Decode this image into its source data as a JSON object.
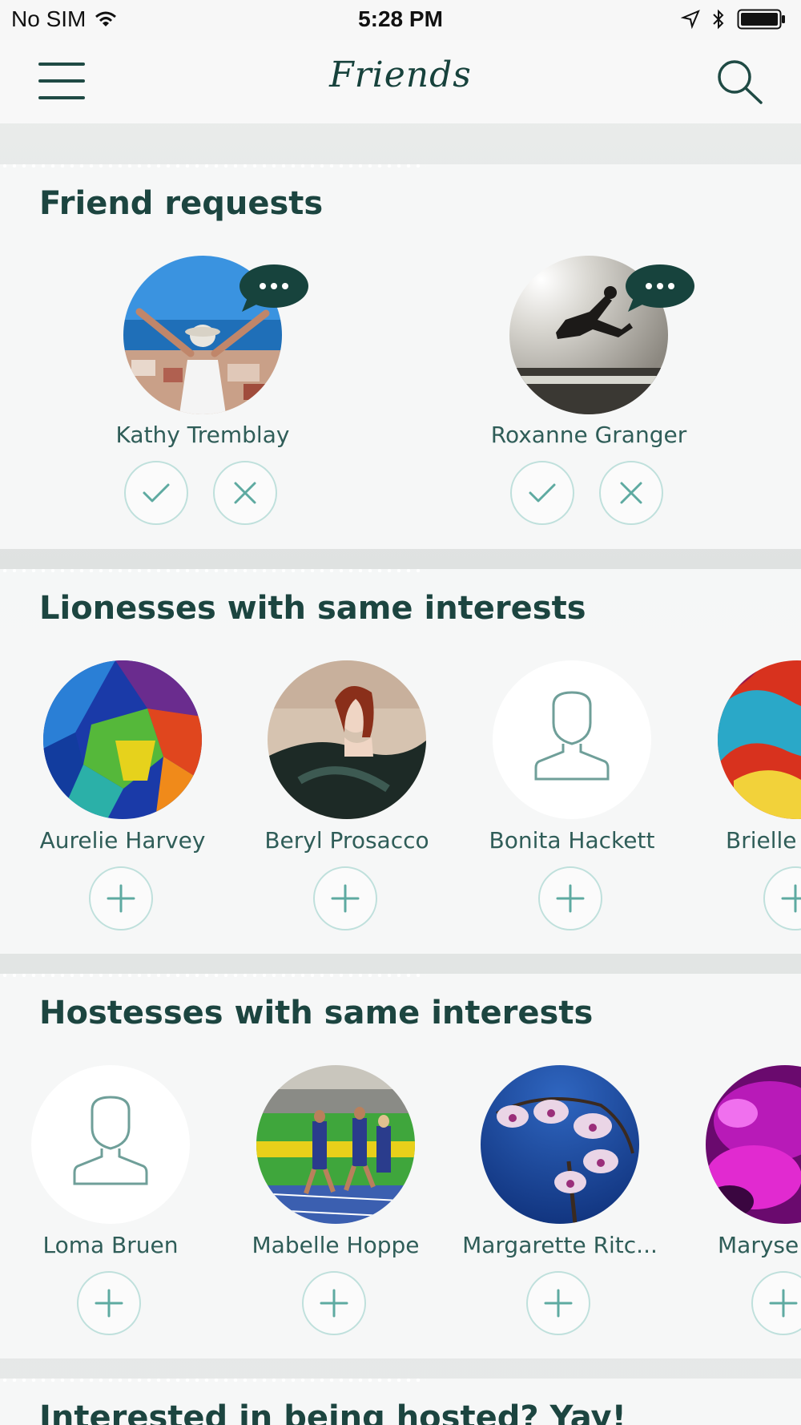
{
  "status_bar": {
    "carrier": "No SIM",
    "time": "5:28 PM"
  },
  "nav": {
    "title": "Friends"
  },
  "friend_requests": {
    "title": "Friend requests",
    "items": [
      {
        "name": "Kathy Tremblay",
        "avatar": "photo-arms-raised-city"
      },
      {
        "name": "Roxanne Granger",
        "avatar": "photo-jump-sunset"
      }
    ]
  },
  "lionesses": {
    "title": "Lionesses with same interests",
    "items": [
      {
        "name": "Aurelie Harvey",
        "avatar": "abstract-colorful"
      },
      {
        "name": "Beryl Prosacco",
        "avatar": "photo-woman-dark"
      },
      {
        "name": "Bonita Hackett",
        "avatar": "placeholder-person-icon"
      },
      {
        "name": "Brielle",
        "avatar": "abstract-red"
      }
    ]
  },
  "hostesses": {
    "title": "Hostesses with same interests",
    "items": [
      {
        "name": "Loma Bruen",
        "avatar": "placeholder-person-icon"
      },
      {
        "name": "Mabelle Hoppe",
        "avatar": "photo-runners"
      },
      {
        "name": "Margarette Ritc...",
        "avatar": "photo-orchids"
      },
      {
        "name": "Maryse",
        "avatar": "abstract-magenta"
      }
    ]
  },
  "next_section": {
    "title": "Interested in being hosted? Yay!"
  },
  "colors": {
    "accent": "#1f4a44",
    "button_border": "#bfe0dc",
    "icon_teal": "#7cbdb5"
  }
}
